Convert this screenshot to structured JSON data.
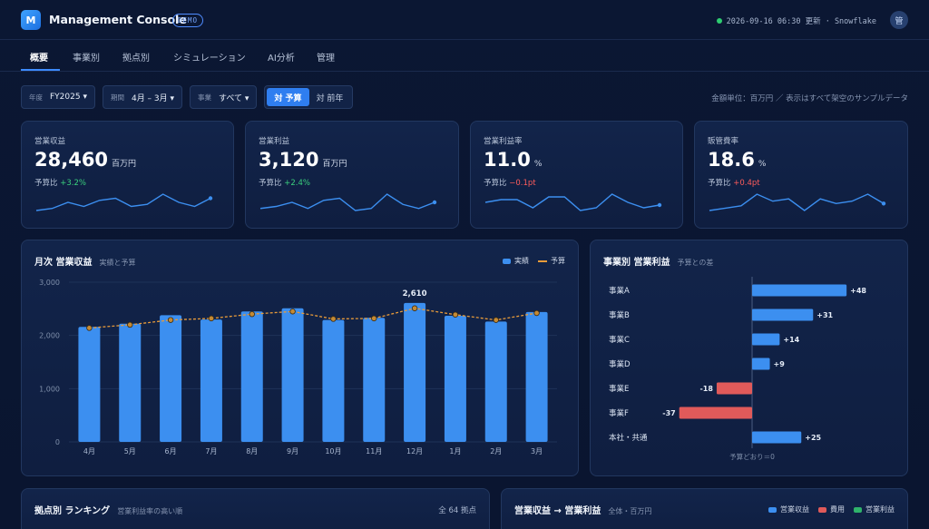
{
  "app": {
    "logo_letter": "M",
    "title": "Management Console",
    "badge": "DEMO",
    "status": "2026-09-16 06:30 更新 · Snowflake",
    "avatar": "管"
  },
  "nav": {
    "tabs": [
      "概要",
      "事業別",
      "拠点別",
      "シミュレーション",
      "AI分析",
      "管理"
    ],
    "active": 0
  },
  "filters": [
    {
      "label": "年度",
      "value": "FY2025 ▾"
    },
    {
      "label": "期間",
      "value": "4月 – 3月 ▾"
    },
    {
      "label": "事業",
      "value": "すべて ▾"
    }
  ],
  "compare": {
    "options": [
      "対 予算",
      "対 前年"
    ],
    "active": 0
  },
  "unit_note": "金額単位：百万円 ／ 表示はすべて架空のサンプルデータ",
  "kpis": [
    {
      "label": "営業収益",
      "value": "28,460",
      "unit": "百万円",
      "sub_label": "予算比",
      "delta": "+3.2%",
      "trend": "pos",
      "spark": [
        8,
        9,
        12,
        10,
        13,
        14,
        10,
        11,
        16,
        12,
        10,
        14
      ]
    },
    {
      "label": "営業利益",
      "value": "3,120",
      "unit": "百万円",
      "sub_label": "予算比",
      "delta": "+2.4%",
      "trend": "pos",
      "spark": [
        9,
        10,
        12,
        9,
        13,
        14,
        8,
        9,
        16,
        11,
        9,
        12
      ]
    },
    {
      "label": "営業利益率",
      "value": "11.0",
      "unit": "%",
      "sub_label": "予算比",
      "delta": "−0.1pt",
      "trend": "neg",
      "spark": [
        12,
        13,
        13,
        10,
        14,
        14,
        9,
        10,
        15,
        12,
        10,
        11
      ]
    },
    {
      "label": "販管費率",
      "value": "18.6",
      "unit": "%",
      "sub_label": "予算比",
      "delta": "+0.4pt",
      "trend": "neg",
      "spark": [
        9,
        10,
        11,
        16,
        13,
        14,
        9,
        14,
        12,
        13,
        16,
        12
      ]
    }
  ],
  "monthly": {
    "title": "月次 営業収益",
    "subtitle": "実績と予算",
    "legend": {
      "actual": "実績",
      "budget": "予算"
    },
    "colors": {
      "actual": "#3c8ff0",
      "budget": "#e89b3a"
    },
    "chart_data": {
      "type": "bar",
      "title": "月次 営業収益",
      "categories": [
        "4月",
        "5月",
        "6月",
        "7月",
        "8月",
        "9月",
        "10月",
        "11月",
        "12月",
        "1月",
        "2月",
        "3月"
      ],
      "series": [
        {
          "name": "実績",
          "type": "bar",
          "values": [
            2160,
            2220,
            2380,
            2300,
            2450,
            2510,
            2290,
            2330,
            2610,
            2370,
            2260,
            2440
          ]
        },
        {
          "name": "予算",
          "type": "line",
          "values": [
            2140,
            2200,
            2290,
            2320,
            2400,
            2450,
            2310,
            2320,
            2510,
            2390,
            2290,
            2420
          ]
        }
      ],
      "yticks": [
        "0",
        "1,000",
        "2,000",
        "3,000"
      ],
      "ylim": [
        0,
        3000
      ],
      "annotation": {
        "index": 8,
        "text": "2,610"
      },
      "grid": true,
      "legend_position": "top-right"
    }
  },
  "segments": {
    "title": "事業別 営業利益",
    "subtitle": "予算との差",
    "colors": {
      "pos": "#3c8ff0",
      "neg": "#e05a5a"
    },
    "chart_data": {
      "type": "bar",
      "title": "事業別 営業利益",
      "orientation": "horizontal",
      "categories": [
        "事業A",
        "事業B",
        "事業C",
        "事業D",
        "事業E",
        "事業F",
        "本社・共通"
      ],
      "values": [
        48,
        31,
        14,
        9,
        -18,
        -37,
        25
      ],
      "labels": [
        "+48",
        "+31",
        "+14",
        "+9",
        "-18",
        "-37",
        "+25"
      ],
      "baseline_label": "予算どおり＝0"
    }
  },
  "ranking": {
    "title": "拠点別 ランキング",
    "subtitle": "営業利益率の高い順",
    "count": "全 64 拠点"
  },
  "flow": {
    "title": "営業収益 → 営業利益",
    "subtitle": "全体・百万円",
    "legend": [
      "営業収益",
      "費用",
      "営業利益"
    ],
    "colors": [
      "#3c8ff0",
      "#e05a5a",
      "#2fb36b"
    ]
  }
}
